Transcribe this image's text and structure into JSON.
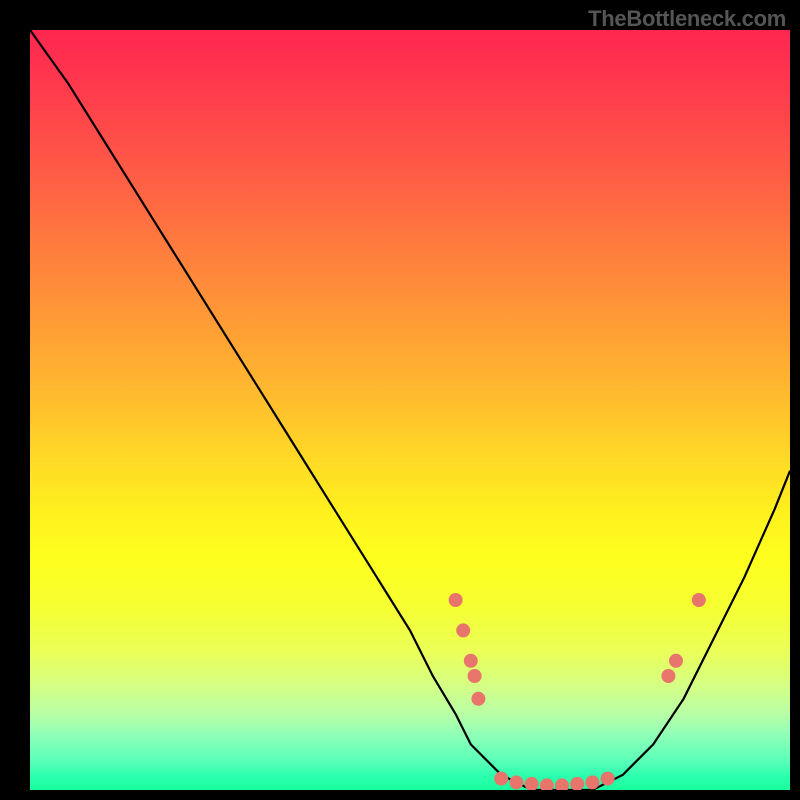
{
  "attribution": "TheBottleneck.com",
  "chart_data": {
    "type": "line",
    "title": "",
    "xlabel": "",
    "ylabel": "",
    "xlim": [
      0,
      100
    ],
    "ylim": [
      0,
      100
    ],
    "series": [
      {
        "name": "curve",
        "x": [
          0,
          5,
          10,
          15,
          20,
          25,
          30,
          35,
          40,
          45,
          50,
          53,
          56,
          58,
          62,
          66,
          70,
          74,
          78,
          82,
          86,
          90,
          94,
          98,
          100
        ],
        "y": [
          100,
          93,
          85,
          77,
          69,
          61,
          53,
          45,
          37,
          29,
          21,
          15,
          10,
          6,
          2,
          0,
          0,
          0,
          2,
          6,
          12,
          20,
          28,
          37,
          42
        ]
      }
    ],
    "markers": [
      {
        "x": 56,
        "y": 25
      },
      {
        "x": 57,
        "y": 21
      },
      {
        "x": 58,
        "y": 17
      },
      {
        "x": 58.5,
        "y": 15
      },
      {
        "x": 59,
        "y": 12
      },
      {
        "x": 62,
        "y": 1.5
      },
      {
        "x": 64,
        "y": 1
      },
      {
        "x": 66,
        "y": 0.8
      },
      {
        "x": 68,
        "y": 0.6
      },
      {
        "x": 70,
        "y": 0.6
      },
      {
        "x": 72,
        "y": 0.8
      },
      {
        "x": 74,
        "y": 1
      },
      {
        "x": 76,
        "y": 1.5
      },
      {
        "x": 84,
        "y": 15
      },
      {
        "x": 85,
        "y": 17
      },
      {
        "x": 88,
        "y": 25
      }
    ],
    "marker_color": "#e8756b",
    "curve_color": "#000000"
  }
}
